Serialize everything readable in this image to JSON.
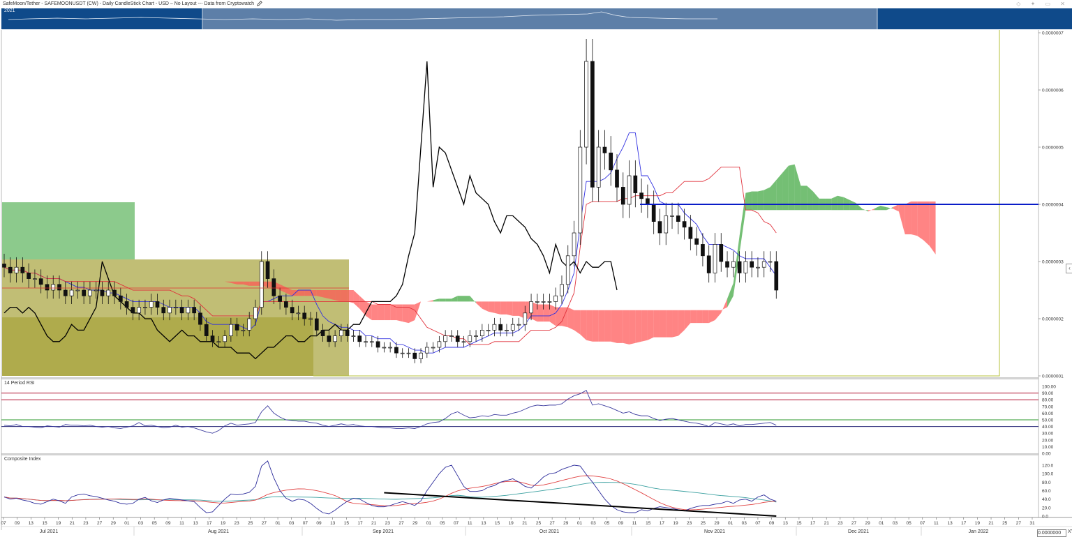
{
  "header": {
    "title": "SafeMoon/Tether - SAFEMOONUSDT (CW) - Daily CandleStick Chart - USD – No Layout --- Data from Cryptowatch",
    "edit_icon": "pencil-icon",
    "window_icons": [
      "diamond-icon",
      "pin-icon",
      "restore-icon",
      "close-icon"
    ]
  },
  "overview": {
    "year_label": "2021"
  },
  "colors": {
    "bull_cloud": "#3fa63f",
    "bear_cloud": "#ff5555",
    "tenkan": "#3030e0",
    "kijun": "#e0303a",
    "chikou": "#000000",
    "horizontal_level": "#0a1cc8",
    "rsi_line": "#3b3b9e",
    "composite_line": "#2a2a9a",
    "composite_fast_ma": "#e04040",
    "composite_slow_ma": "#3aa0a0",
    "olive_box": "#a6a23a",
    "green_box": "#3fa63f",
    "overview_bg": "#0f4a8a",
    "rsi_overbought": "#b01030",
    "rsi_mid": "#2e9a2e"
  },
  "chart_data": [
    {
      "type": "candlestick",
      "title": "SafeMoon/Tether - SAFEMOONUSDT (CW) - Daily CandleStick Chart - USD",
      "y_axis_labels": [
        "0.0000001",
        "0.0000002",
        "0.0000003",
        "0.0000004",
        "0.0000005",
        "0.0000006",
        "0.0000007"
      ],
      "ylim": [
        1e-07,
        7e-07
      ],
      "x_range": [
        "2021-07-07",
        "2022-01-31"
      ],
      "closes": [
        2.9e-07,
        2.8e-07,
        2.9e-07,
        2.8e-07,
        2.7e-07,
        2.7e-07,
        2.6e-07,
        2.5e-07,
        2.6e-07,
        2.5e-07,
        2.4e-07,
        2.5e-07,
        2.5e-07,
        2.4e-07,
        2.5e-07,
        2.5e-07,
        2.4e-07,
        2.5e-07,
        2.4e-07,
        2.3e-07,
        2.2e-07,
        2.1e-07,
        2.2e-07,
        2.2e-07,
        2.3e-07,
        2.2e-07,
        2.1e-07,
        2.2e-07,
        2.2e-07,
        2.1e-07,
        2.2e-07,
        2.1e-07,
        1.9e-07,
        1.7e-07,
        1.6e-07,
        1.6e-07,
        1.7e-07,
        1.9e-07,
        1.8e-07,
        1.8e-07,
        2e-07,
        2.2e-07,
        3e-07,
        2.7e-07,
        2.4e-07,
        2.3e-07,
        2.2e-07,
        2.1e-07,
        2.1e-07,
        2e-07,
        2e-07,
        1.8e-07,
        1.7e-07,
        1.6e-07,
        1.7e-07,
        1.8e-07,
        1.7e-07,
        1.7e-07,
        1.6e-07,
        1.6e-07,
        1.6e-07,
        1.5e-07,
        1.5e-07,
        1.5e-07,
        1.4e-07,
        1.4e-07,
        1.4e-07,
        1.3e-07,
        1.4e-07,
        1.5e-07,
        1.5e-07,
        1.6e-07,
        1.7e-07,
        1.7e-07,
        1.6e-07,
        1.6e-07,
        1.7e-07,
        1.7e-07,
        1.8e-07,
        1.8e-07,
        1.9e-07,
        1.8e-07,
        1.8e-07,
        1.9e-07,
        1.9e-07,
        2.1e-07,
        2.3e-07,
        2.3e-07,
        2.3e-07,
        2.3e-07,
        2.4e-07,
        2.6e-07,
        3.1e-07,
        3.5e-07,
        5e-07,
        6.5e-07,
        4.3e-07,
        5e-07,
        4.9e-07,
        4.6e-07,
        4.3e-07,
        4e-07,
        4.5e-07,
        4.2e-07,
        4.1e-07,
        4e-07,
        3.7e-07,
        3.5e-07,
        3.8e-07,
        3.8e-07,
        3.7e-07,
        3.6e-07,
        3.4e-07,
        3.3e-07,
        3.1e-07,
        2.8e-07,
        3.3e-07,
        3e-07,
        2.9e-07,
        3e-07,
        2.8e-07,
        3e-07,
        2.9e-07,
        2.9e-07,
        3e-07,
        3e-07,
        2.5e-07
      ],
      "rsi": [
        42,
        41,
        43,
        40,
        40,
        39,
        38,
        41,
        40,
        39,
        43,
        42,
        42,
        41,
        42,
        40,
        39,
        40,
        38,
        37,
        39,
        41,
        46,
        41,
        42,
        40,
        38,
        39,
        42,
        39,
        40,
        38,
        35,
        32,
        30,
        34,
        41,
        45,
        42,
        43,
        44,
        46,
        62,
        71,
        60,
        54,
        50,
        49,
        48,
        48,
        46,
        45,
        42,
        40,
        42,
        44,
        42,
        43,
        41,
        40,
        40,
        39,
        38,
        38,
        37,
        37,
        38,
        37,
        40,
        44,
        46,
        47,
        52,
        59,
        62,
        57,
        53,
        54,
        56,
        55,
        58,
        57,
        57,
        60,
        62,
        66,
        70,
        72,
        71,
        72,
        72,
        74,
        81,
        86,
        89,
        94,
        72,
        74,
        71,
        68,
        64,
        60,
        62,
        58,
        56,
        56,
        52,
        49,
        51,
        52,
        50,
        48,
        46,
        45,
        43,
        40,
        46,
        44,
        42,
        44,
        41,
        43,
        43,
        44,
        45,
        46,
        42
      ],
      "rsi_levels": [
        90,
        80,
        50,
        40
      ],
      "rsi_labels": [
        "0.00",
        "10.00",
        "20.00",
        "30.00",
        "40.00",
        "50.00",
        "60.00",
        "70.00",
        "80.00",
        "90.00",
        "100.00"
      ],
      "composite": [
        45,
        40,
        42,
        38,
        35,
        30,
        28,
        34,
        40,
        36,
        30,
        45,
        50,
        52,
        48,
        46,
        42,
        38,
        35,
        30,
        28,
        30,
        40,
        44,
        36,
        32,
        38,
        42,
        40,
        38,
        36,
        34,
        20,
        8,
        10,
        25,
        40,
        52,
        50,
        52,
        56,
        70,
        118,
        130,
        90,
        60,
        42,
        35,
        40,
        38,
        30,
        18,
        8,
        5,
        14,
        25,
        35,
        42,
        40,
        32,
        25,
        22,
        22,
        25,
        30,
        34,
        30,
        25,
        36,
        60,
        80,
        100,
        115,
        120,
        95,
        70,
        58,
        58,
        60,
        68,
        72,
        80,
        84,
        88,
        80,
        70,
        66,
        78,
        92,
        100,
        102,
        110,
        115,
        120,
        118,
        98,
        80,
        60,
        40,
        25,
        15,
        10,
        8,
        8,
        15,
        12,
        18,
        22,
        20,
        18,
        15,
        12,
        18,
        22,
        25,
        25,
        28,
        30,
        35,
        30,
        38,
        40,
        35,
        45,
        50,
        40,
        35
      ],
      "composite_labels": [
        "0.0",
        "20.0",
        "40.0",
        "60.0",
        "80.0",
        "100.0",
        "120.0"
      ],
      "x_day_ticks": [
        "07",
        "09",
        "13",
        "15",
        "19",
        "21",
        "23",
        "27",
        "29",
        "01",
        "03",
        "05",
        "09",
        "11",
        "13",
        "17",
        "19",
        "23",
        "25",
        "27",
        "01",
        "03",
        "07",
        "09",
        "13",
        "15",
        "17",
        "21",
        "23",
        "27",
        "29",
        "01",
        "05",
        "07",
        "11",
        "13",
        "15",
        "19",
        "21",
        "25",
        "27",
        "29",
        "01",
        "03",
        "05",
        "09",
        "11",
        "15",
        "17",
        "19",
        "23",
        "25",
        "29",
        "01",
        "03",
        "07",
        "09",
        "13",
        "15",
        "17",
        "21",
        "23",
        "27",
        "29",
        "01",
        "03",
        "05",
        "07",
        "11",
        "13",
        "17",
        "19",
        "21",
        "25",
        "27",
        "31"
      ],
      "x_month_ticks": [
        "Jul 2021",
        "Aug 2021",
        "Sep 2021",
        "Oct 2021",
        "Nov 2021",
        "Dec 2021",
        "Jan 2022"
      ],
      "horizontal_level": 4e-07,
      "last_price_label": "0.0000000"
    }
  ],
  "panels": {
    "rsi_title": "14 Period RSI",
    "composite_title": "Composite Index",
    "scale_value": "0.0000000",
    "scale_btn": "XY"
  }
}
